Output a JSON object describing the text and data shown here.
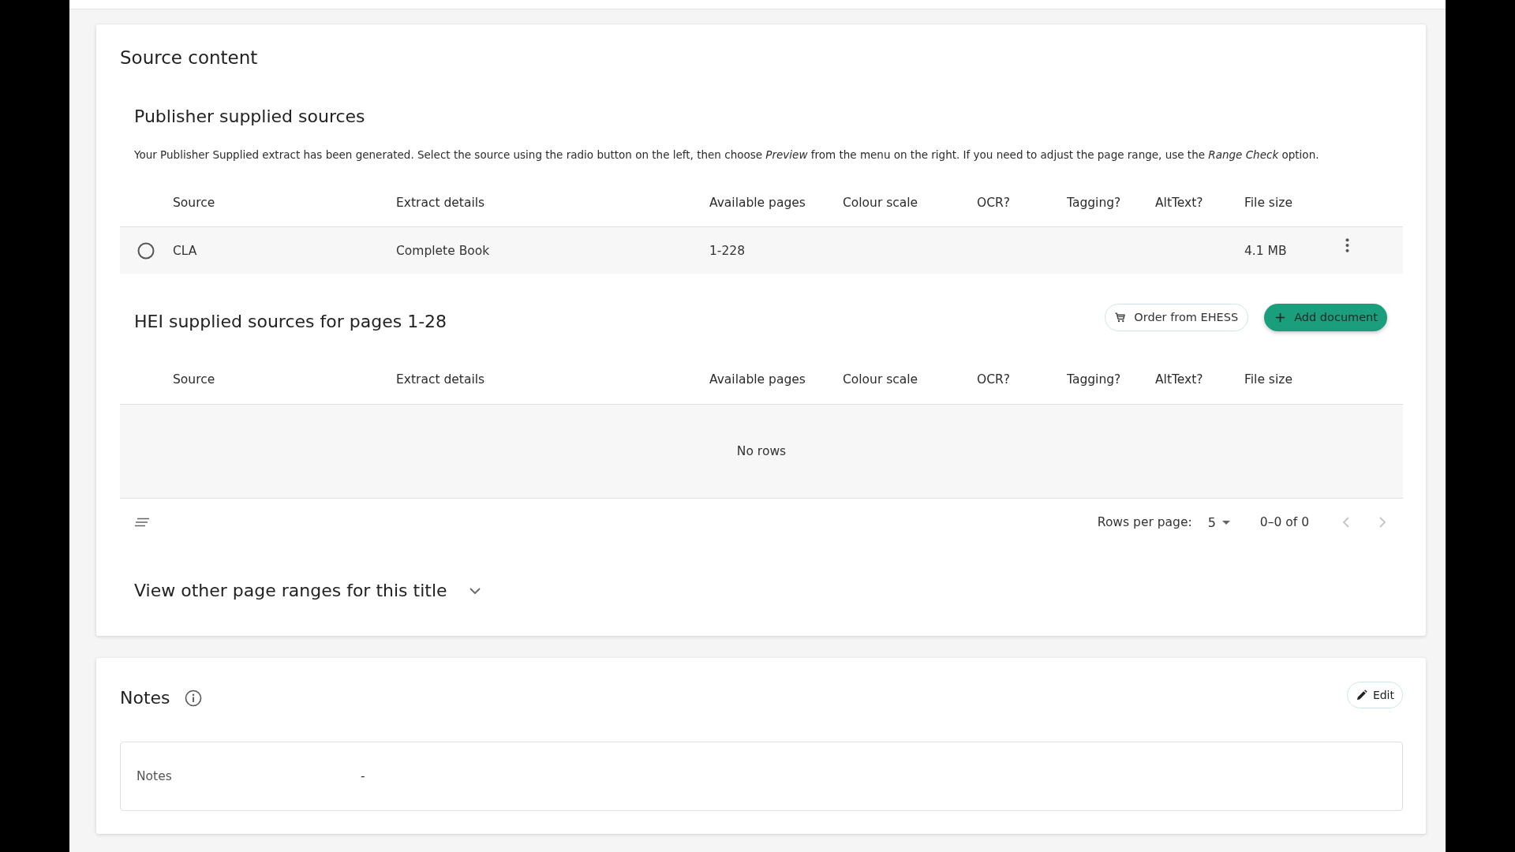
{
  "source_content": {
    "title": "Source content",
    "publisher_sources": {
      "title": "Publisher supplied sources",
      "description": "Your Publisher Supplied extract has been generated. Select the source using the radio button on the left, then choose *Preview* from the menu on the right. If you need to adjust the page range, use the *Range Check* option.",
      "columns": [
        "Source",
        "Extract details",
        "Available pages",
        "Colour scale",
        "OCR?",
        "Tagging?",
        "AltText?",
        "File size"
      ],
      "rows": [
        {
          "selected": false,
          "source": "CLA",
          "extract_details": "Complete Book",
          "available_pages": "1-228",
          "file_size": "4.1 MB"
        }
      ]
    },
    "hei_sources": {
      "title": "HEI supplied sources for pages 1-28",
      "buttons": [
        {
          "kind": "outlined",
          "label": "Order from EHESS"
        },
        {
          "kind": "primary",
          "label": "Add document"
        }
      ],
      "columns": [
        "Source",
        "Extract details",
        "Available pages",
        "Colour scale",
        "OCR?",
        "Tagging?",
        "AltText?",
        "File size"
      ],
      "empty_message": "No rows",
      "pagination": {
        "rows_per_page_label": "Rows per page:",
        "rows_per_page": "5",
        "range": "0–0 of 0",
        "previous_disabled": true,
        "next_disabled": true
      }
    },
    "other_ranges": {
      "label": "View other page ranges for this title",
      "expanded": false
    }
  },
  "notes": {
    "title": "Notes",
    "edit_button": "Edit",
    "fields": [
      {
        "label": "Notes",
        "value": "-"
      }
    ]
  }
}
